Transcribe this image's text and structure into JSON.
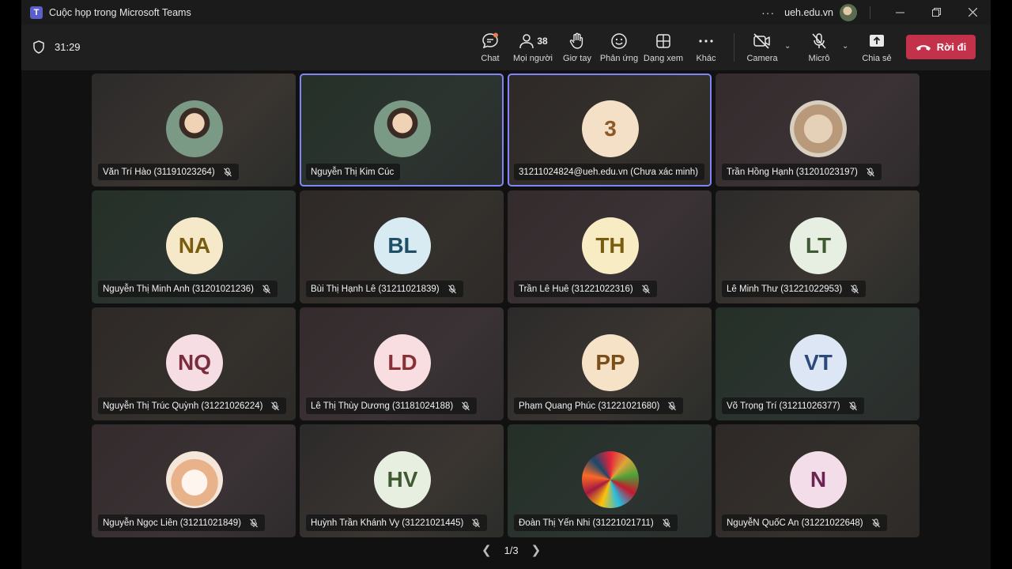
{
  "window": {
    "title": "Cuộc họp trong Microsoft Teams",
    "org": "ueh.edu.vn"
  },
  "meeting": {
    "timer": "31:29"
  },
  "toolbar": {
    "chat": "Chat",
    "people": "Mọi người",
    "people_count": "38",
    "raise": "Giơ tay",
    "react": "Phản ứng",
    "view": "Dạng xem",
    "more": "Khác",
    "camera": "Camera",
    "mic": "Micrô",
    "share": "Chia sẻ",
    "leave": "Rời đi"
  },
  "participants": [
    {
      "name": "Văn Trí Hào (31191023264)",
      "initials": "",
      "avatar": "photo-person",
      "bubble": "#6b7c66",
      "fg": "#333",
      "active": false,
      "muted": true
    },
    {
      "name": "Nguyễn Thị Kim Cúc",
      "initials": "",
      "avatar": "photo-person",
      "bubble": "#d8b48a",
      "fg": "#333",
      "active": true,
      "muted": false
    },
    {
      "name": "31211024824@ueh.edu.vn (Chưa xác minh)",
      "initials": "3",
      "avatar": "initials",
      "bubble": "#f4e0c6",
      "fg": "#8a5a2b",
      "active": true,
      "muted": false
    },
    {
      "name": "Trần Hồng Hạnh (31201023197)",
      "initials": "",
      "avatar": "photo-cat",
      "bubble": "#c9b59c",
      "fg": "#333",
      "active": false,
      "muted": true
    },
    {
      "name": "Nguyễn Thị Minh Anh (31201021236)",
      "initials": "NA",
      "avatar": "initials",
      "bubble": "#f6e9c9",
      "fg": "#7a5c10",
      "active": false,
      "muted": true
    },
    {
      "name": "Bùi Thị Hạnh Lê (31211021839)",
      "initials": "BL",
      "avatar": "initials",
      "bubble": "#d9ebf2",
      "fg": "#1f4f63",
      "active": false,
      "muted": true
    },
    {
      "name": "Trần Lê Huê (31221022316)",
      "initials": "TH",
      "avatar": "initials",
      "bubble": "#f8ecc4",
      "fg": "#7a5c10",
      "active": false,
      "muted": true
    },
    {
      "name": "Lê Minh Thư (31221022953)",
      "initials": "LT",
      "avatar": "initials",
      "bubble": "#e6efe2",
      "fg": "#3f5a33",
      "active": false,
      "muted": true
    },
    {
      "name": "Nguyễn Thị Trúc Quỳnh (31221026224)",
      "initials": "NQ",
      "avatar": "initials",
      "bubble": "#f6dde3",
      "fg": "#7a2b3c",
      "active": false,
      "muted": true
    },
    {
      "name": "Lê Thị Thùy Dương (31181024188)",
      "initials": "LD",
      "avatar": "initials",
      "bubble": "#f8dee0",
      "fg": "#8a2f36",
      "active": false,
      "muted": true
    },
    {
      "name": "Phạm Quang Phúc (31221021680)",
      "initials": "PP",
      "avatar": "initials",
      "bubble": "#f6e2c6",
      "fg": "#7a4f1a",
      "active": false,
      "muted": true
    },
    {
      "name": "Võ Trọng Trí (31211026377)",
      "initials": "VT",
      "avatar": "initials",
      "bubble": "#dde6f4",
      "fg": "#2b4a7a",
      "active": false,
      "muted": true
    },
    {
      "name": "Nguyễn Ngọc Liên (31211021849)",
      "initials": "",
      "avatar": "photo-cat2",
      "bubble": "#e8c9a8",
      "fg": "#333",
      "active": false,
      "muted": true
    },
    {
      "name": "Huỳnh Trần Khánh Vy (31221021445)",
      "initials": "HV",
      "avatar": "initials",
      "bubble": "#e7efe1",
      "fg": "#3f5a33",
      "active": false,
      "muted": true
    },
    {
      "name": "Đoàn Thị Yến Nhi (31221021711)",
      "initials": "",
      "avatar": "photo-goals",
      "bubble": "#cfd8c4",
      "fg": "#333",
      "active": false,
      "muted": true
    },
    {
      "name": "NguyễN QuốC An (31221022648)",
      "initials": "N",
      "avatar": "initials",
      "bubble": "#f3dde8",
      "fg": "#6b2350",
      "active": false,
      "muted": true
    }
  ],
  "pager": {
    "label": "1/3"
  },
  "colors": {
    "accent": "#7f85f5",
    "leave": "#c4314b",
    "brand": "#5b5fc7"
  }
}
